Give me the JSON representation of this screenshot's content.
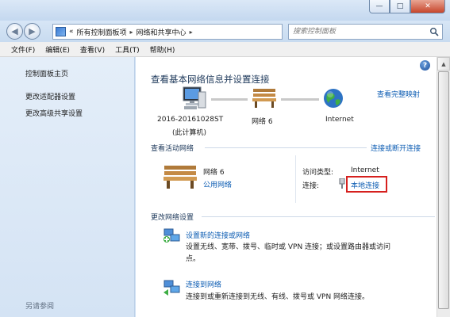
{
  "window": {
    "minimize": "—",
    "maximize": "□",
    "close": "✕"
  },
  "nav": {
    "back_glyph": "◀",
    "forward_glyph": "▶",
    "breadcrumb": {
      "lead": "«",
      "items": [
        "所有控制面板项",
        "网络和共享中心"
      ],
      "separator": "▸"
    },
    "dropdown_glyph": "▾",
    "refresh_glyph": "⟳",
    "search_placeholder": "搜索控制面板"
  },
  "menu": [
    "文件(F)",
    "编辑(E)",
    "查看(V)",
    "工具(T)",
    "帮助(H)"
  ],
  "sidebar": {
    "items": [
      "控制面板主页",
      "更改适配器设置",
      "更改高级共享设置"
    ],
    "see_also": "另请参阅"
  },
  "main": {
    "title": "查看基本网络信息并设置连接",
    "full_map_link": "查看完整映射",
    "help_glyph": "?",
    "map": {
      "computer_line1": "2016-20161028ST",
      "computer_line2": "(此计算机)",
      "network": "网络  6",
      "internet": "Internet"
    },
    "active": {
      "section": "查看活动网络",
      "connect_link": "连接或断开连接",
      "network_name": "网络  6",
      "network_type": "公用网络",
      "access_label": "访问类型:",
      "access_value": "Internet",
      "conn_label": "连接:",
      "conn_value": "本地连接"
    },
    "change": {
      "section": "更改网络设置",
      "tasks": [
        {
          "title": "设置新的连接或网络",
          "desc1": "设置无线、宽带、拨号、临时或 VPN 连接；或设置路由器或访问",
          "desc2": "点。"
        },
        {
          "title": "连接到网络",
          "desc1": "连接到或重新连接到无线、有线、拨号或 VPN 网络连接。"
        }
      ]
    }
  },
  "colors": {
    "link": "#0d5db3",
    "title": "#1e395b",
    "highlight_box": "#d6201e"
  },
  "icons": [
    "control-panel-icon",
    "search-icon",
    "computer-icon",
    "bench-icon",
    "globe-icon",
    "ethernet-icon",
    "network-setup-icon",
    "connect-network-icon",
    "help-icon"
  ]
}
